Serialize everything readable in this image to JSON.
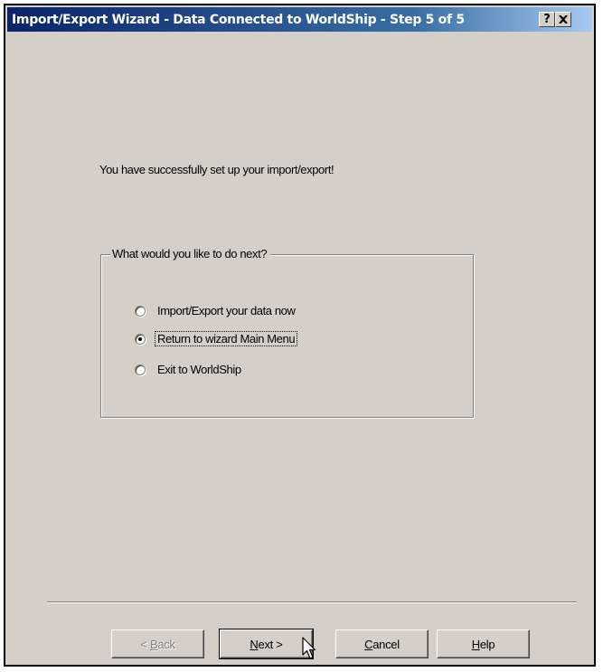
{
  "window": {
    "title": "Import/Export Wizard - Data Connected to WorldShip - Step 5 of 5",
    "help_button": "?",
    "close_button": "✕"
  },
  "message": "You have successfully set up your import/export!",
  "group": {
    "legend": "What would you like to do next?",
    "options": [
      {
        "label": "Import/Export your data now",
        "checked": false
      },
      {
        "label": "Return to wizard Main Menu",
        "checked": true
      },
      {
        "label": "Exit to WorldShip",
        "checked": false
      }
    ]
  },
  "buttons": {
    "back": {
      "pre": "< ",
      "accel": "B",
      "post": "ack"
    },
    "next": {
      "accel": "N",
      "post": "ext >"
    },
    "cancel": {
      "accel": "C",
      "post": "ancel"
    },
    "help": {
      "accel": "H",
      "post": "elp"
    }
  },
  "icons": {
    "help": "question-mark",
    "close": "x-mark",
    "pointer": "arrow-cursor"
  }
}
